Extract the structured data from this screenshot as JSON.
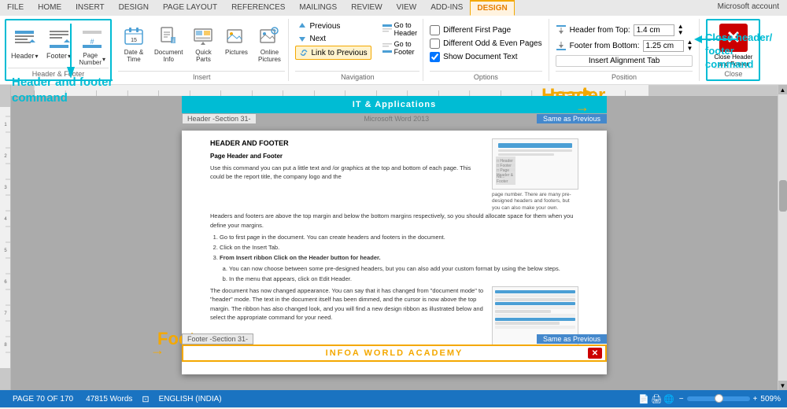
{
  "app": {
    "title": "Microsoft Word 2013",
    "account": "Microsoft account"
  },
  "tabs": [
    {
      "label": "FILE",
      "id": "file"
    },
    {
      "label": "HOME",
      "id": "home"
    },
    {
      "label": "INSERT",
      "id": "insert"
    },
    {
      "label": "DESIGN",
      "id": "design"
    },
    {
      "label": "PAGE LAYOUT",
      "id": "pagelayout"
    },
    {
      "label": "REFERENCES",
      "id": "references"
    },
    {
      "label": "MAILINGS",
      "id": "mailings"
    },
    {
      "label": "REVIEW",
      "id": "review"
    },
    {
      "label": "VIEW",
      "id": "view"
    },
    {
      "label": "ADD-INS",
      "id": "addins"
    },
    {
      "label": "DESIGN",
      "id": "design2",
      "active": true
    }
  ],
  "ribbon": {
    "groups": {
      "header_footer": {
        "label": "Header & Footer",
        "buttons": [
          {
            "label": "Header",
            "icon": "header-icon"
          },
          {
            "label": "Footer",
            "icon": "footer-icon"
          },
          {
            "label": "Page\nNumber",
            "icon": "pagenumber-icon"
          }
        ]
      },
      "insert": {
        "label": "Insert",
        "buttons": [
          {
            "label": "Date &\nTime",
            "icon": "datetime-icon"
          },
          {
            "label": "Document\nInfo",
            "icon": "docinfo-icon"
          },
          {
            "label": "Quick\nParts",
            "icon": "quickparts-icon"
          },
          {
            "label": "Pictures",
            "icon": "pictures-icon"
          },
          {
            "label": "Online\nPictures",
            "icon": "onlinepics-icon"
          }
        ]
      },
      "navigation": {
        "label": "Navigation",
        "items": [
          {
            "label": "Go to\nHeader",
            "icon": "goto-icon"
          },
          {
            "label": "Go to\nFooter",
            "icon": "goto-icon"
          },
          {
            "label": "Previous",
            "icon": "prev-icon"
          },
          {
            "label": "Next",
            "icon": "next-icon"
          },
          {
            "label": "Link to Previous",
            "icon": "link-icon",
            "highlighted": true
          }
        ]
      },
      "options": {
        "label": "Options",
        "items": [
          {
            "label": "Different First Page",
            "checked": false
          },
          {
            "label": "Different Odd & Even Pages",
            "checked": false
          },
          {
            "label": "Show Document Text",
            "checked": true
          }
        ]
      },
      "position": {
        "label": "Position",
        "items": [
          {
            "label": "Header from Top:",
            "value": "1.4 cm"
          },
          {
            "label": "Footer from Bottom:",
            "value": "1.25 cm"
          },
          {
            "label": "Insert Alignment Tab",
            "is_button": true
          }
        ]
      },
      "close": {
        "label": "Close",
        "button_label": "Close Header\nand Footer"
      }
    }
  },
  "document": {
    "header_bar_text": "IT & Applications",
    "section_label": "Header -Section 31-",
    "word_app_label": "Microsoft Word 2013",
    "same_as_prev": "Same as Previous",
    "content_heading": "HEADER AND FOOTER",
    "content_subheading": "Page Header and Footer",
    "content_text": "Use this command you can put a little text and /or graphics at the top and bottom of each page. This could be the report title, the company logo and the page number. There are many pre-designed headers and footers, but you can also make your own.",
    "content_text2": "Headers and footers are above the top margin and below the bottom margins respectively, so you should allocate space for them when you define your margins.",
    "list_items": [
      "Go to first page in the document. You can create headers and footers in the document.",
      "Click on the Insert Tab.",
      "From Insert ribbon Click on the Header button for header.",
      "a. You can now choose between some pre-designed headers, but you can also add your custom format by using the below steps.",
      "b. In the menu that appears, click on Edit Header.",
      "The document has now changed appearance. You can say that it has changed from \"document mode\" to \"header\" mode. The text in the document itself has been dimmed, and the cursor is now above the top margin. The ribbon has also changed look, and you will find a new design ribbon as illustrated below and select the appropriate command for your need."
    ],
    "footer_section_label": "Footer -Section 31-",
    "footer_same_as_prev": "Same as Previous",
    "footer_title": "INFOA WORLD ACADEMY"
  },
  "annotations": {
    "header_footer_cmd": "Header and footer\ncommand",
    "footer_label": "Footer",
    "header_label": "Header",
    "close_hf": "Close header/\nfooter\ncommand"
  },
  "status_bar": {
    "page": "PAGE 70 OF 170",
    "words": "47815 Words",
    "language": "ENGLISH (INDIA)",
    "zoom_percent": "509%"
  }
}
